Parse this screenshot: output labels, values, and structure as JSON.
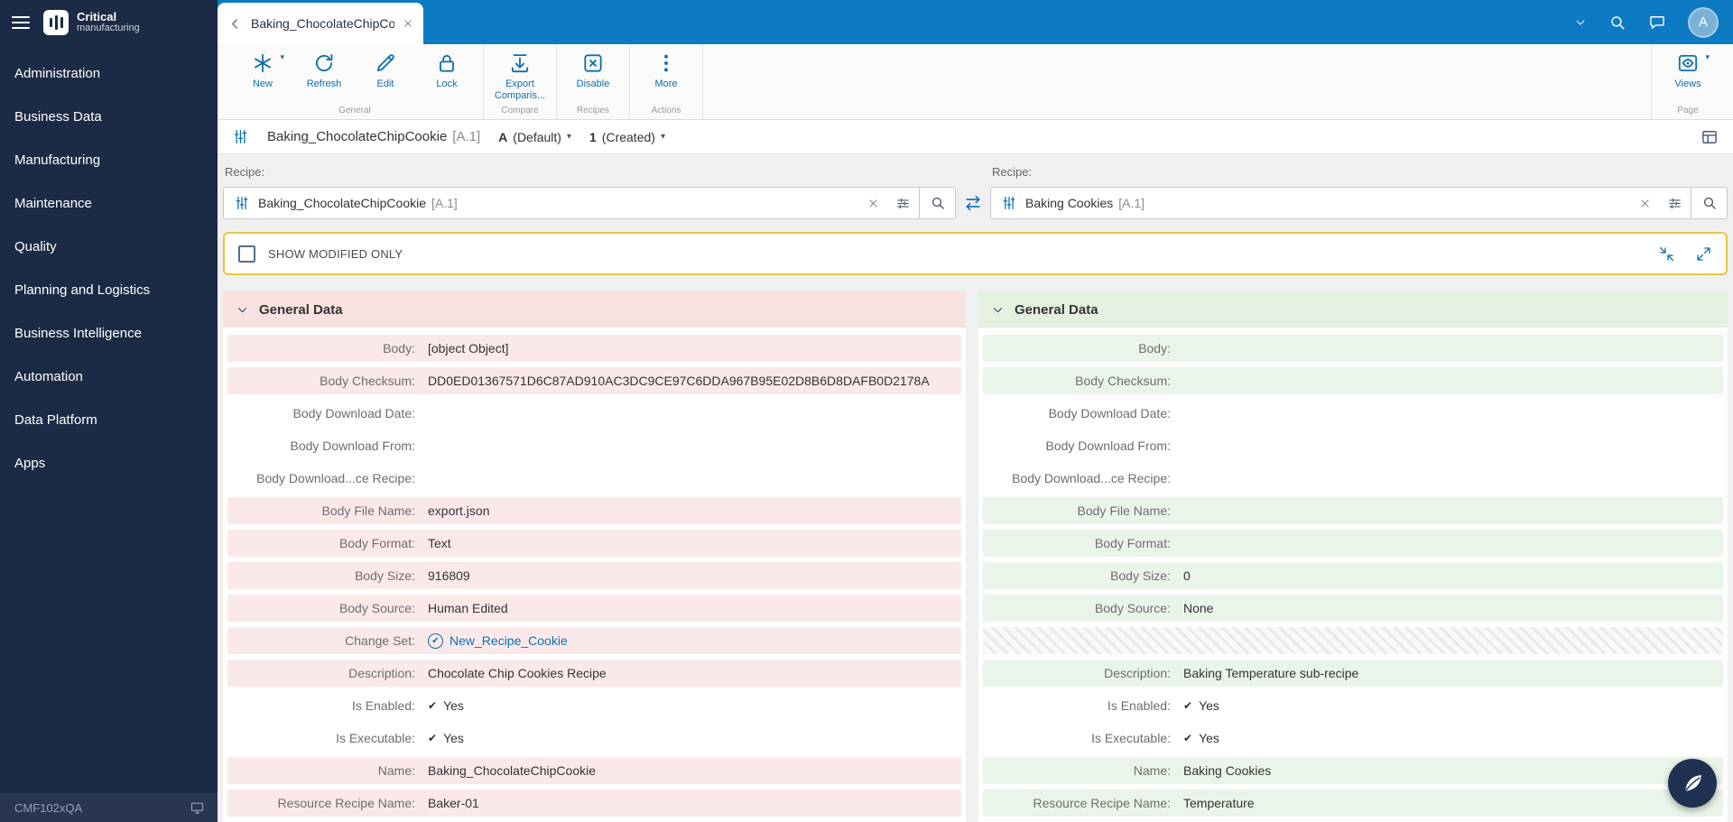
{
  "colors": {
    "topbar_blue": "#0c7bc3",
    "sidebar_navy": "#1b2b45",
    "accent_blue": "#0e6fae",
    "highlight_yellow": "#e7c63f",
    "left_tint": "#fbe9ea",
    "left_header": "#f8e2df",
    "right_tint": "#eaf5e9",
    "right_header": "#e4f1e1",
    "link_blue": "#0e6fae",
    "avatar_bg": "#7cb1d6"
  },
  "sidebar": {
    "logo_line1": "Critical",
    "logo_line2": "manufacturing",
    "items": [
      {
        "label": "Administration"
      },
      {
        "label": "Business Data"
      },
      {
        "label": "Manufacturing"
      },
      {
        "label": "Maintenance"
      },
      {
        "label": "Quality"
      },
      {
        "label": "Planning and Logistics"
      },
      {
        "label": "Business Intelligence"
      },
      {
        "label": "Automation"
      },
      {
        "label": "Data Platform"
      },
      {
        "label": "Apps"
      }
    ],
    "footer_label": "CMF102xQA"
  },
  "topbar": {
    "tab_title": "Baking_ChocolateChipCooki",
    "avatar_letter": "A",
    "icons": [
      "chevron-down-icon",
      "search-icon",
      "messages-icon"
    ]
  },
  "toolbar": {
    "groups": [
      {
        "label": "General",
        "buttons": [
          {
            "label": "New",
            "icon": "new-icon",
            "caret": true
          },
          {
            "label": "Refresh",
            "icon": "refresh-icon"
          },
          {
            "label": "Edit",
            "icon": "edit-icon"
          },
          {
            "label": "Lock",
            "icon": "lock-icon"
          }
        ]
      },
      {
        "label": "Compare",
        "buttons": [
          {
            "label": "Export Comparis...",
            "icon": "export-comparison-icon"
          }
        ]
      },
      {
        "label": "Recipes",
        "buttons": [
          {
            "label": "Disable",
            "icon": "disable-icon"
          }
        ]
      },
      {
        "label": "Actions",
        "buttons": [
          {
            "label": "More",
            "icon": "more-icon"
          }
        ]
      }
    ],
    "right_group": {
      "label": "Page",
      "buttons": [
        {
          "label": "Views",
          "icon": "views-icon",
          "caret": true
        }
      ]
    }
  },
  "entity_bar": {
    "title": "Baking_ChocolateChipCookie",
    "version_tag": "[A.1]",
    "version_letter": "A",
    "version_state": "(Default)",
    "revision_number": "1",
    "revision_state": "(Created)"
  },
  "compare": {
    "left": {
      "label": "Recipe:",
      "value": "Baking_ChocolateChipCookie",
      "version": "[A.1]"
    },
    "right": {
      "label": "Recipe:",
      "value": "Baking Cookies",
      "version": "[A.1]"
    }
  },
  "modified_bar": {
    "label": "SHOW MODIFIED ONLY",
    "checked": false
  },
  "panels": {
    "left": {
      "section_title": "General Data",
      "rows": [
        {
          "label": "Body:",
          "value": "[object Object]",
          "state": "modified"
        },
        {
          "label": "Body Checksum:",
          "value": "DD0ED01367571D6C87AD910AC3DC9CE97C6DDA967B95E02D8B6D8DAFB0D2178A",
          "state": "modified"
        },
        {
          "label": "Body Download Date:",
          "value": "",
          "state": "same"
        },
        {
          "label": "Body Download From:",
          "value": "",
          "state": "same"
        },
        {
          "label": "Body Download...ce Recipe:",
          "value": "",
          "state": "same"
        },
        {
          "label": "Body File Name:",
          "value": "export.json",
          "state": "modified"
        },
        {
          "label": "Body Format:",
          "value": "Text",
          "state": "modified"
        },
        {
          "label": "Body Size:",
          "value": "916809",
          "state": "modified"
        },
        {
          "label": "Body Source:",
          "value": "Human Edited",
          "state": "modified"
        },
        {
          "label": "Change Set:",
          "value": "New_Recipe_Cookie",
          "state": "modified",
          "icon": "circle-check"
        },
        {
          "label": "Description:",
          "value": "Chocolate Chip Cookies Recipe",
          "state": "modified"
        },
        {
          "label": "Is Enabled:",
          "value": "Yes",
          "state": "same",
          "icon": "check"
        },
        {
          "label": "Is Executable:",
          "value": "Yes",
          "state": "same",
          "icon": "check"
        },
        {
          "label": "Name:",
          "value": "Baking_ChocolateChipCookie",
          "state": "modified"
        },
        {
          "label": "Resource Recipe Name:",
          "value": "Baker-01",
          "state": "modified"
        }
      ]
    },
    "right": {
      "section_title": "General Data",
      "rows": [
        {
          "label": "Body:",
          "value": "",
          "state": "modified"
        },
        {
          "label": "Body Checksum:",
          "value": "",
          "state": "modified"
        },
        {
          "label": "Body Download Date:",
          "value": "",
          "state": "same"
        },
        {
          "label": "Body Download From:",
          "value": "",
          "state": "same"
        },
        {
          "label": "Body Download...ce Recipe:",
          "value": "",
          "state": "same"
        },
        {
          "label": "Body File Name:",
          "value": "",
          "state": "modified"
        },
        {
          "label": "Body Format:",
          "value": "",
          "state": "modified"
        },
        {
          "label": "Body Size:",
          "value": "0",
          "state": "modified"
        },
        {
          "label": "Body Source:",
          "value": "None",
          "state": "modified"
        },
        {
          "label": "",
          "value": "",
          "state": "missing"
        },
        {
          "label": "Description:",
          "value": "Baking Temperature sub-recipe",
          "state": "modified"
        },
        {
          "label": "Is Enabled:",
          "value": "Yes",
          "state": "same",
          "icon": "check"
        },
        {
          "label": "Is Executable:",
          "value": "Yes",
          "state": "same",
          "icon": "check"
        },
        {
          "label": "Name:",
          "value": "Baking Cookies",
          "state": "modified"
        },
        {
          "label": "Resource Recipe Name:",
          "value": "Temperature",
          "state": "modified"
        }
      ]
    }
  }
}
